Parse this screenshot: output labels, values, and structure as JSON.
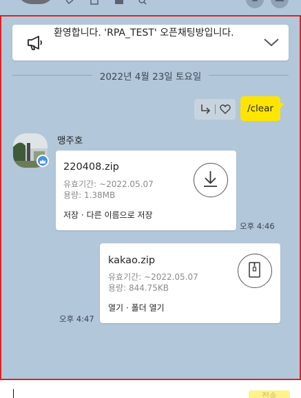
{
  "notice": {
    "text": "환영합니다. 'RPA_TEST' 오픈채팅방입니다."
  },
  "date_divider": "2022년 4월 23일 토요일",
  "my_message": {
    "text": "/clear"
  },
  "sender": {
    "name": "맹주호"
  },
  "file1": {
    "name": "220408.zip",
    "expiry": "유효기간: ~2022.05.07",
    "size": "용량: 1.38MB",
    "save": "저장",
    "separator": "·",
    "save_as": "다른 이름으로 저장",
    "time": "오후 4:46"
  },
  "file2": {
    "name": "kakao.zip",
    "expiry": "유효기간: ~2022.05.07",
    "size": "용량: 844.75KB",
    "open": "열기",
    "separator": "·",
    "open_folder": "폴더 열기",
    "time": "오후 4:47"
  },
  "input": {
    "send_label": "전송"
  },
  "colors": {
    "background": "#b2c7d9",
    "my_bubble": "#fee500",
    "highlight": "#e0211f"
  }
}
